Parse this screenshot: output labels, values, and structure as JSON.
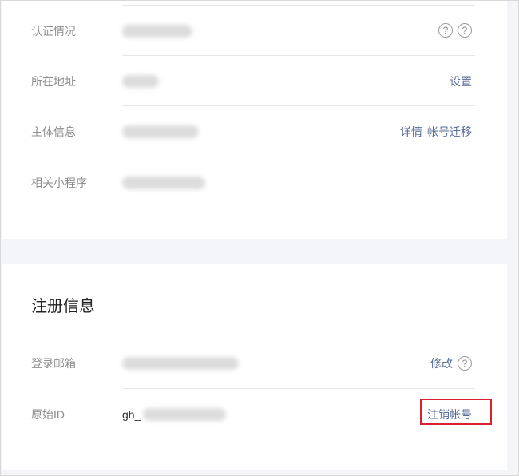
{
  "account_info": {
    "rows": [
      {
        "label": "认证情况",
        "value": "",
        "actions": []
      },
      {
        "label": "所在地址",
        "value": "",
        "actions": [
          "设置"
        ]
      },
      {
        "label": "主体信息",
        "value": "",
        "actions": [
          "详情",
          "帐号迁移"
        ]
      },
      {
        "label": "相关小程序",
        "value": "",
        "actions": []
      }
    ],
    "help_glyph": "?"
  },
  "registration": {
    "title": "注册信息",
    "email_label": "登录邮箱",
    "email_action": "修改",
    "original_id_label": "原始ID",
    "original_id_prefix": "gh_",
    "cancel_account_label": "注销帐号"
  },
  "colors": {
    "link": "#576b95",
    "label": "#8d8d8d",
    "highlight": "#d8222e"
  }
}
